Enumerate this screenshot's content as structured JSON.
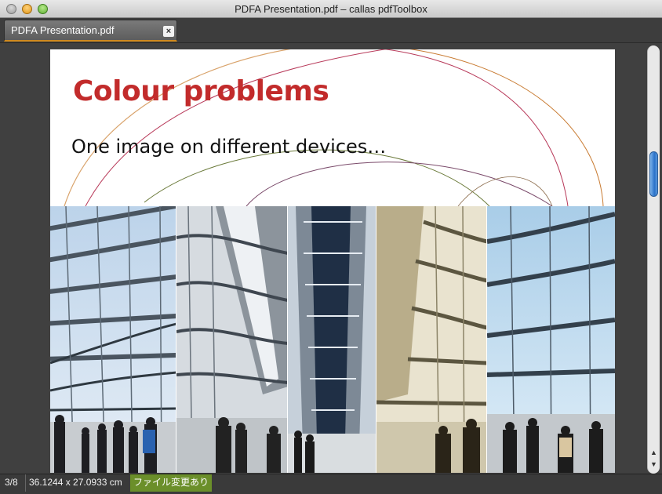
{
  "window": {
    "title": "PDFA Presentation.pdf – callas pdfToolbox"
  },
  "tab": {
    "label": "PDFA Presentation.pdf",
    "close_glyph": "×"
  },
  "slide": {
    "title": "Colour problems",
    "subtitle": "One image on different devices…",
    "title_color": "#c22b2b"
  },
  "scrollbar": {
    "up_glyph": "▲",
    "down_glyph": "▼"
  },
  "status": {
    "page": "3/8",
    "size": "36.1244 x 27.0933 cm",
    "modified": "ファイル変更あり"
  },
  "icons": [
    "close-icon",
    "minimize-icon",
    "zoom-icon",
    "tab-close-icon",
    "scroll-up-icon",
    "scroll-down-icon"
  ]
}
